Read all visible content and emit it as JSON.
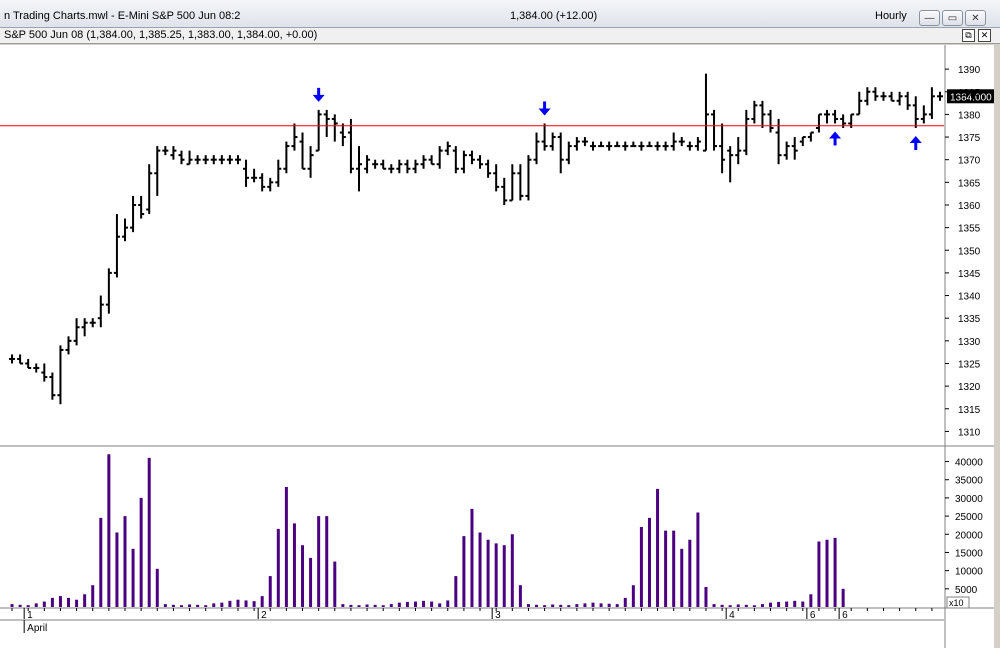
{
  "window": {
    "title": "n Trading Charts.mwl - E-Mini S&P 500 Jun 08:2",
    "price_summary": "1,384.00 (+12.00)",
    "interval": "Hourly",
    "controls": {
      "minimize": "—",
      "restore": "▭",
      "close": "✕"
    }
  },
  "chart_header": {
    "symbol_line": "S&P 500 Jun 08 (1,384.00, 1,385.25, 1,383.00, 1,384.00, +0.00)",
    "restore_glyph": "⧉",
    "close_glyph": "✕"
  },
  "chart_data": [
    {
      "type": "ohlc",
      "ylim": [
        1307,
        1394
      ],
      "y_ticks": [
        1310,
        1315,
        1320,
        1325,
        1330,
        1335,
        1340,
        1345,
        1350,
        1355,
        1360,
        1365,
        1370,
        1375,
        1380,
        1385,
        1390
      ],
      "last_price_label": "1384.000",
      "horizontal_line": 1377.5,
      "line_color": "#ff0000",
      "bar_color": "#000000",
      "arrow_color": "#0000ff",
      "arrows": [
        {
          "bar": 38,
          "direction": "down"
        },
        {
          "bar": 66,
          "direction": "down"
        },
        {
          "bar": 102,
          "direction": "up"
        },
        {
          "bar": 112,
          "direction": "up"
        }
      ],
      "bars": [
        [
          1326,
          1327,
          1325,
          1326
        ],
        [
          1326,
          1327,
          1325,
          1325
        ],
        [
          1325,
          1326,
          1324,
          1324
        ],
        [
          1324,
          1325,
          1323,
          1324
        ],
        [
          1323,
          1325,
          1321,
          1322
        ],
        [
          1322,
          1323,
          1317,
          1318
        ],
        [
          1318,
          1329,
          1316,
          1328
        ],
        [
          1328,
          1331,
          1327,
          1330
        ],
        [
          1330,
          1335,
          1329,
          1333
        ],
        [
          1333,
          1335,
          1331,
          1334
        ],
        [
          1334,
          1335,
          1333,
          1334
        ],
        [
          1335,
          1340,
          1333,
          1338
        ],
        [
          1338,
          1346,
          1336,
          1345
        ],
        [
          1345,
          1358,
          1344,
          1353
        ],
        [
          1353,
          1357,
          1352,
          1355
        ],
        [
          1355,
          1362,
          1354,
          1360
        ],
        [
          1360,
          1362,
          1357,
          1358
        ],
        [
          1359,
          1369,
          1358,
          1367
        ],
        [
          1367,
          1373,
          1362,
          1372
        ],
        [
          1372,
          1373,
          1371,
          1372
        ],
        [
          1371,
          1373,
          1370,
          1372
        ],
        [
          1371,
          1372,
          1369,
          1370
        ],
        [
          1369,
          1372,
          1369,
          1370
        ],
        [
          1370,
          1371,
          1369,
          1370
        ],
        [
          1370,
          1371,
          1369,
          1370
        ],
        [
          1370,
          1371,
          1369,
          1370
        ],
        [
          1370,
          1371,
          1369,
          1370
        ],
        [
          1370,
          1371,
          1369,
          1370
        ],
        [
          1370,
          1371,
          1369,
          1370
        ],
        [
          1368,
          1370,
          1364,
          1366
        ],
        [
          1366,
          1368,
          1365,
          1366
        ],
        [
          1366,
          1367,
          1363,
          1364
        ],
        [
          1364,
          1366,
          1363,
          1365
        ],
        [
          1365,
          1370,
          1364,
          1368
        ],
        [
          1368,
          1374,
          1367,
          1373
        ],
        [
          1373,
          1378,
          1372,
          1375
        ],
        [
          1374,
          1376,
          1368,
          1368
        ],
        [
          1368,
          1373,
          1366,
          1371
        ],
        [
          1372,
          1381,
          1372,
          1380
        ],
        [
          1380,
          1381,
          1375,
          1379
        ],
        [
          1379,
          1380,
          1374,
          1378
        ],
        [
          1376,
          1378,
          1373,
          1375
        ],
        [
          1376,
          1379,
          1367,
          1368
        ],
        [
          1368,
          1373,
          1363,
          1369
        ],
        [
          1368,
          1371,
          1367,
          1370
        ],
        [
          1369,
          1370,
          1368,
          1369
        ],
        [
          1369,
          1370,
          1368,
          1368
        ],
        [
          1368,
          1369,
          1367,
          1368
        ],
        [
          1368,
          1370,
          1367,
          1369
        ],
        [
          1369,
          1370,
          1367,
          1368
        ],
        [
          1368,
          1370,
          1367,
          1369
        ],
        [
          1369,
          1371,
          1368,
          1370
        ],
        [
          1370,
          1371,
          1369,
          1369
        ],
        [
          1369,
          1373,
          1368,
          1372
        ],
        [
          1372,
          1374,
          1371,
          1373
        ],
        [
          1372,
          1373,
          1367,
          1368
        ],
        [
          1368,
          1372,
          1367,
          1371
        ],
        [
          1371,
          1372,
          1369,
          1370
        ],
        [
          1370,
          1371,
          1368,
          1369
        ],
        [
          1369,
          1370,
          1366,
          1367
        ],
        [
          1367,
          1369,
          1363,
          1364
        ],
        [
          1364,
          1366,
          1360,
          1361
        ],
        [
          1361,
          1369,
          1361,
          1367
        ],
        [
          1367,
          1369,
          1361,
          1362
        ],
        [
          1362,
          1371,
          1361,
          1370
        ],
        [
          1370,
          1376,
          1369,
          1374
        ],
        [
          1374,
          1378,
          1372,
          1373
        ],
        [
          1373,
          1376,
          1372,
          1375
        ],
        [
          1375,
          1376,
          1367,
          1370
        ],
        [
          1370,
          1374,
          1369,
          1373
        ],
        [
          1373,
          1375,
          1372,
          1374
        ],
        [
          1374,
          1375,
          1373,
          1374
        ],
        [
          1373,
          1374,
          1372,
          1373
        ],
        [
          1373,
          1374,
          1373,
          1373
        ],
        [
          1373,
          1374,
          1372,
          1373
        ],
        [
          1373,
          1374,
          1373,
          1373
        ],
        [
          1373,
          1374,
          1372,
          1373
        ],
        [
          1373,
          1374,
          1373,
          1373
        ],
        [
          1373,
          1374,
          1372,
          1373
        ],
        [
          1373,
          1374,
          1373,
          1373
        ],
        [
          1373,
          1374,
          1372,
          1373
        ],
        [
          1373,
          1374,
          1372,
          1373
        ],
        [
          1373,
          1376,
          1372,
          1374
        ],
        [
          1374,
          1375,
          1373,
          1374
        ],
        [
          1373,
          1374,
          1372,
          1373
        ],
        [
          1373,
          1375,
          1372,
          1374
        ],
        [
          1372,
          1389,
          1372,
          1380
        ],
        [
          1380,
          1381,
          1372,
          1373
        ],
        [
          1373,
          1378,
          1367,
          1370
        ],
        [
          1372,
          1373,
          1365,
          1371
        ],
        [
          1371,
          1375,
          1369,
          1372
        ],
        [
          1372,
          1381,
          1371,
          1379
        ],
        [
          1379,
          1383,
          1378,
          1382
        ],
        [
          1382,
          1383,
          1377,
          1380
        ],
        [
          1380,
          1381,
          1376,
          1377
        ],
        [
          1376,
          1379,
          1369,
          1371
        ],
        [
          1371,
          1374,
          1370,
          1373
        ],
        [
          1373,
          1375,
          1370,
          1372
        ],
        [
          1374,
          1375,
          1373,
          1375
        ],
        [
          1375,
          1376,
          1374,
          1376
        ],
        [
          1377,
          1380,
          1376,
          1380
        ],
        [
          1380,
          1381,
          1378,
          1380
        ],
        [
          1380,
          1381,
          1378,
          1379
        ],
        [
          1379,
          1380,
          1377,
          1378
        ],
        [
          1378,
          1380,
          1377,
          1380
        ],
        [
          1380,
          1385,
          1380,
          1383
        ],
        [
          1383,
          1386,
          1382,
          1385
        ],
        [
          1385,
          1386,
          1383,
          1384
        ],
        [
          1384,
          1385,
          1383,
          1384
        ],
        [
          1384,
          1385,
          1383,
          1383
        ],
        [
          1383,
          1385,
          1382,
          1384
        ],
        [
          1384,
          1385,
          1381,
          1382
        ],
        [
          1382,
          1384,
          1377,
          1379
        ],
        [
          1379,
          1382,
          1378,
          1380
        ],
        [
          1380,
          1386,
          1379,
          1384
        ],
        [
          1384,
          1385,
          1383,
          1384
        ]
      ]
    },
    {
      "type": "bar",
      "series": [],
      "ylim": [
        0,
        44000
      ],
      "y_ticks": [
        5000,
        10000,
        15000,
        20000,
        25000,
        30000,
        35000,
        40000
      ],
      "y_tick_labels": [
        "5000",
        "10000",
        "15000",
        "20000",
        "25000",
        "30000",
        "35000",
        "40000"
      ],
      "multiplier_label": "x10",
      "bar_color": "#4b0082",
      "values": [
        800,
        600,
        500,
        1000,
        1500,
        2500,
        3000,
        2500,
        2000,
        3500,
        6000,
        24500,
        42000,
        20500,
        25000,
        16000,
        30000,
        41000,
        10500,
        800,
        600,
        500,
        700,
        600,
        500,
        1000,
        1200,
        1700,
        2000,
        1800,
        1600,
        3000,
        8500,
        21500,
        33000,
        23000,
        17000,
        13500,
        25000,
        25000,
        12500,
        800,
        600,
        500,
        700,
        600,
        500,
        800,
        1200,
        1400,
        1500,
        1700,
        1500,
        1000,
        1800,
        8500,
        19500,
        27000,
        20500,
        18500,
        17500,
        17000,
        20000,
        6000,
        800,
        600,
        500,
        700,
        600,
        500,
        800,
        1000,
        1200,
        1000,
        900,
        800,
        2500,
        6000,
        22000,
        24500,
        32500,
        21000,
        21000,
        16000,
        18500,
        26000,
        5500,
        800,
        600,
        500,
        700,
        600,
        500,
        800,
        1200,
        1400,
        1500,
        1700,
        1500,
        3500,
        18000,
        18500,
        19000,
        5000
      ]
    }
  ],
  "time_axis": {
    "labels": [
      {
        "text": "1",
        "bar": 2
      },
      {
        "text": "2",
        "bar": 31
      },
      {
        "text": "3",
        "bar": 60
      },
      {
        "text": "4",
        "bar": 89
      },
      {
        "text": "6",
        "bar": 99
      },
      {
        "text": "6",
        "bar": 103
      }
    ],
    "month_label": "April"
  }
}
